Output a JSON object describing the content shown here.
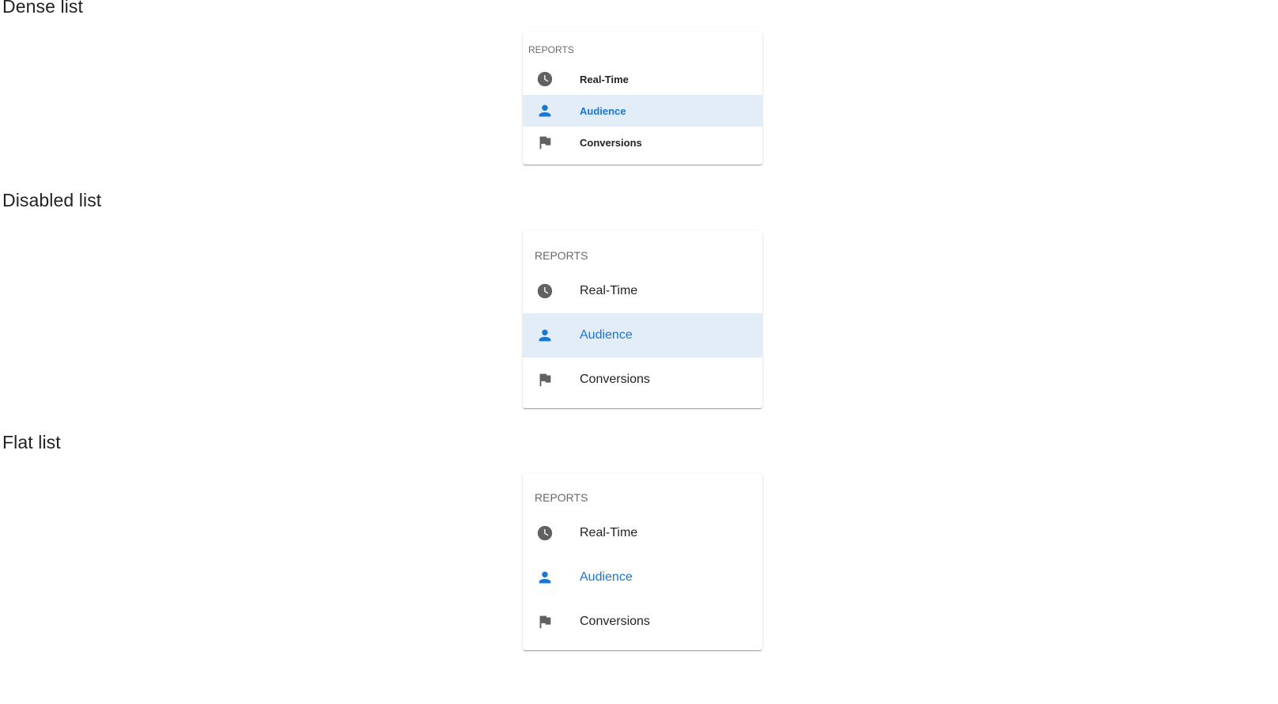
{
  "sections": [
    {
      "title": "Dense list",
      "subheader": "REPORTS",
      "items": [
        {
          "label": "Real-Time",
          "icon": "clock-icon"
        },
        {
          "label": "Audience",
          "icon": "person-icon",
          "active": true
        },
        {
          "label": "Conversions",
          "icon": "flag-icon"
        }
      ]
    },
    {
      "title": "Disabled list",
      "subheader": "REPORTS",
      "items": [
        {
          "label": "Real-Time",
          "icon": "clock-icon"
        },
        {
          "label": "Audience",
          "icon": "person-icon",
          "active": true
        },
        {
          "label": "Conversions",
          "icon": "flag-icon"
        }
      ]
    },
    {
      "title": "Flat list",
      "subheader": "REPORTS",
      "items": [
        {
          "label": "Real-Time",
          "icon": "clock-icon"
        },
        {
          "label": "Audience",
          "icon": "person-icon",
          "active": true
        },
        {
          "label": "Conversions",
          "icon": "flag-icon"
        }
      ]
    }
  ],
  "colors": {
    "accent": "#1976d2",
    "active_background": "#e3edf8",
    "icon": "#616161"
  }
}
